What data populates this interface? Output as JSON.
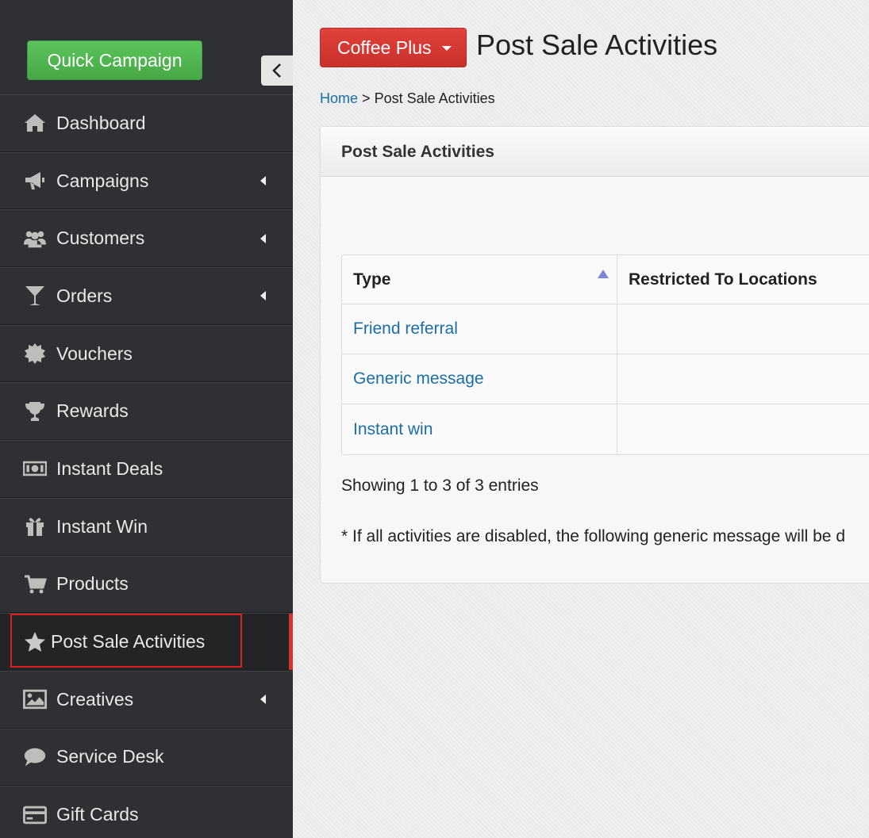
{
  "sidebar": {
    "quick_campaign": "Quick Campaign",
    "items": [
      {
        "label": "Dashboard",
        "icon": "home-icon"
      },
      {
        "label": "Campaigns",
        "icon": "megaphone-icon"
      },
      {
        "label": "Customers",
        "icon": "users-icon"
      },
      {
        "label": "Orders",
        "icon": "glass-icon"
      },
      {
        "label": "Vouchers",
        "icon": "badge-icon"
      },
      {
        "label": "Rewards",
        "icon": "trophy-icon"
      },
      {
        "label": "Instant Deals",
        "icon": "money-icon"
      },
      {
        "label": "Instant Win",
        "icon": "gift-icon"
      },
      {
        "label": "Products",
        "icon": "cart-icon"
      },
      {
        "label": "Post Sale Activities",
        "icon": "star-icon"
      },
      {
        "label": "Creatives",
        "icon": "picture-icon"
      },
      {
        "label": "Service Desk",
        "icon": "chat-icon"
      },
      {
        "label": "Gift Cards",
        "icon": "credit-card-icon"
      }
    ],
    "active_item": "Post Sale Activities"
  },
  "header": {
    "brand_button": "Coffee Plus",
    "title": "Post Sale Activities"
  },
  "breadcrumb": {
    "home": "Home",
    "separator": ">",
    "current": "Post Sale Activities"
  },
  "panel": {
    "title": "Post Sale Activities",
    "table": {
      "columns": [
        "Type",
        "Restricted To Locations"
      ],
      "rows": [
        [
          "Friend referral",
          ""
        ],
        [
          "Generic message",
          ""
        ],
        [
          "Instant win",
          ""
        ]
      ]
    },
    "showing": "Showing 1 to 3 of 3 entries",
    "note": "* If all activities are disabled, the following generic message will be d"
  },
  "colors": {
    "sidebar_bg": "#2f3033",
    "quick_campaign": "#4cae4c",
    "brand_button": "#d9342e",
    "link": "#1a6ea8",
    "active_marker": "#d9332b"
  }
}
